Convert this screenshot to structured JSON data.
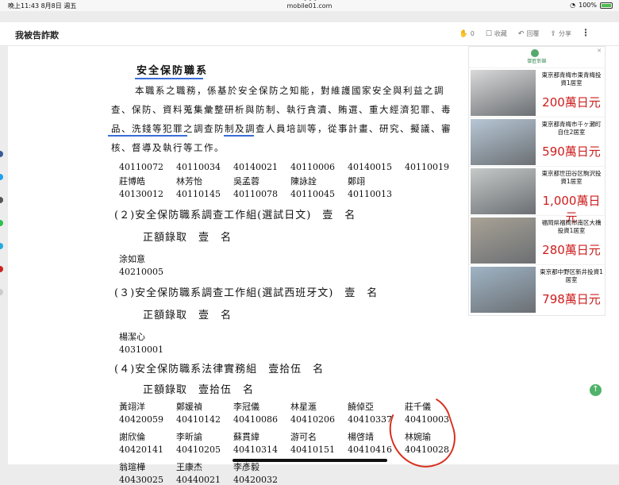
{
  "status": {
    "time": "晚上11:43  8月8日 週五",
    "url": "mobile01.com",
    "battery": "100%"
  },
  "toolbar": {
    "title": "我被告詐欺",
    "like_count": "0",
    "bookmark": "收藏",
    "reply": "回覆",
    "share": "分享",
    "more": "⋮"
  },
  "doc": {
    "section_title": "安全保防職系",
    "paragraph": "本職系之職務，係基於安全保防之知能，對維護國家安全與利益之調查、保防、資料蒐集彙整研析與防制、執行貪瀆、賄選、重大經濟犯罪、毒品、洗錢等犯罪之調查防制及調查人員培訓等，從事計畫、研究、擬議、審核、督導及執行等工作。",
    "clipped_row": [
      "40110072",
      "40110034",
      "40140021",
      "40110006",
      "40140015",
      "40110019"
    ],
    "group1_names": [
      "莊博皓",
      "林芳怡",
      "吳孟蓉",
      "陳詠詮",
      "鄭翊"
    ],
    "group1_ids": [
      "40130012",
      "40110145",
      "40110078",
      "40110045",
      "40110013"
    ],
    "s2_heading": "(２)安全保防職系調查工作組(選試日文)　壹　名",
    "s2_sub": "正額錄取　壹　名",
    "s2_name": "涂如意",
    "s2_id": "40210005",
    "s3_heading": "(３)安全保防職系調查工作組(選試西班牙文)　壹　名",
    "s3_sub": "正額錄取　壹　名",
    "s3_name": "楊潔心",
    "s3_id": "40310001",
    "s4_heading": "(４)安全保防職系法律實務組　壹拾伍　名",
    "s4_sub": "正額錄取　壹拾伍　名",
    "s4_rows": [
      {
        "names": [
          "黃翊洋",
          "鄭媛禎",
          "李冠儀",
          "林星滙",
          "饒倬亞",
          "莊千儀"
        ],
        "ids": [
          "40420059",
          "40410142",
          "40410086",
          "40410206",
          "40410337",
          "40410003"
        ]
      },
      {
        "names": [
          "謝欣倫",
          "李昕諭",
          "蘇貫緯",
          "游可名",
          "楊啓靖",
          "林婉瑜"
        ],
        "ids": [
          "40420141",
          "40410205",
          "40410314",
          "40410151",
          "40410416",
          "40410028"
        ]
      },
      {
        "names": [
          "翁瑄樺",
          "王康杰",
          "李彥毅"
        ],
        "ids": [
          "40430025",
          "40440021",
          "40420032"
        ]
      }
    ]
  },
  "ads": {
    "brand": "御匠彰錦",
    "items": [
      {
        "title": "東京都青梅市東青梅投資1居室",
        "price": "200萬日元",
        "color": "#d9d9d9"
      },
      {
        "title": "東京都青梅市千ヶ瀬町自住2居室",
        "price": "590萬日元",
        "color": "#b7c7d6"
      },
      {
        "title": "東京都世田谷区駒沢投資1居室",
        "price": "1,000萬日元",
        "color": "#c5c9c8"
      },
      {
        "title": "福岡県福岡市南区大橋投資1居室",
        "price": "280萬日元",
        "color": "#a9a296"
      },
      {
        "title": "東京都中野区新井投資1居室",
        "price": "798萬日元",
        "color": "#9fb4c5"
      }
    ]
  },
  "side_dots": [
    "#3b5998",
    "#1da1f2",
    "#555555",
    "#2dbf4f",
    "#24a9e1",
    "#cc2222",
    "#cccccc"
  ]
}
